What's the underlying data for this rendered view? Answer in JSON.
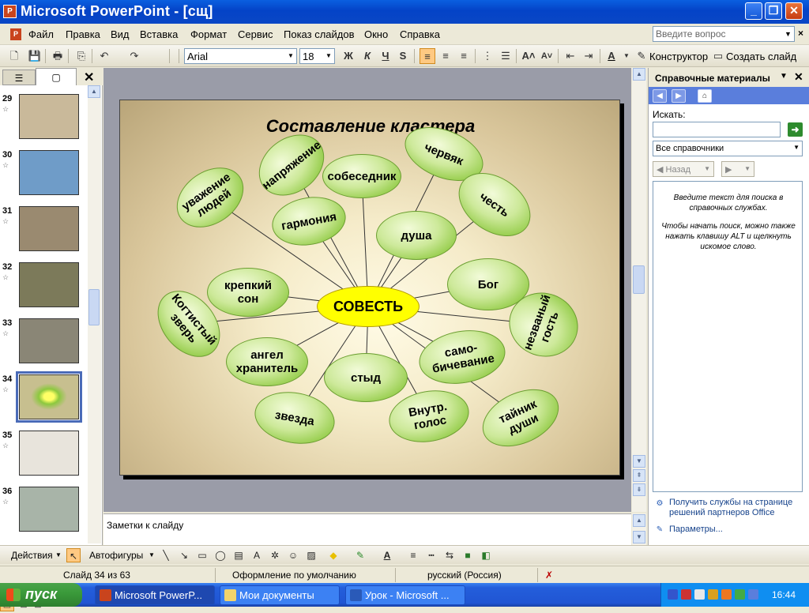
{
  "window": {
    "title": "Microsoft PowerPoint - [сщ]",
    "app_icon": "powerpoint-icon"
  },
  "menu": {
    "items": [
      "Файл",
      "Правка",
      "Вид",
      "Вставка",
      "Формат",
      "Сервис",
      "Показ слайдов",
      "Окно",
      "Справка"
    ],
    "ask_placeholder": "Введите вопрос"
  },
  "toolbar": {
    "font": "Arial",
    "size": "18",
    "designer_label": "Конструктор",
    "new_slide_label": "Создать слайд"
  },
  "slides_panel": {
    "thumbnails": [
      {
        "num": "29",
        "bg": "#c9b99a"
      },
      {
        "num": "30",
        "bg": "#6f9cc8"
      },
      {
        "num": "31",
        "bg": "#9a8a70"
      },
      {
        "num": "32",
        "bg": "#7c7a5a"
      },
      {
        "num": "33",
        "bg": "#8a8676"
      },
      {
        "num": "34",
        "bg": "#c7bf8f"
      },
      {
        "num": "35",
        "bg": "#e8e4dc"
      },
      {
        "num": "36",
        "bg": "#a8b4a8"
      }
    ],
    "selected": "34"
  },
  "slide": {
    "title": "Составление кластера",
    "center": "СОВЕСТЬ",
    "nodes": [
      "уважение\nлюдей",
      "напряжение",
      "собеседник",
      "червяк",
      "честь",
      "гармония",
      "душа",
      "крепкий\nсон",
      "Бог",
      "Когтистый\nзверь",
      "незваный\nгость",
      "ангел\nхранитель",
      "само-\nбичевание",
      "стыд",
      "звезда",
      "Внутр.\nголос",
      "тайник\nдуши"
    ]
  },
  "notes": {
    "placeholder": "Заметки к слайду"
  },
  "taskpane": {
    "title": "Справочные материалы",
    "search_label": "Искать:",
    "search_value": "",
    "source": "Все справочники",
    "back_label": "Назад",
    "info1": "Введите текст для поиска в справочных службах.",
    "info2": "Чтобы начать поиск, можно также нажать клавишу ALT и щелкнуть искомое слово.",
    "link1": "Получить службы на странице решений партнеров Office",
    "link2": "Параметры..."
  },
  "drawing": {
    "actions_label": "Действия",
    "autoshapes_label": "Автофигуры"
  },
  "status": {
    "slide": "Слайд 34 из 63",
    "design": "Оформление по умолчанию",
    "language": "русский (Россия)"
  },
  "taskbar": {
    "start": "пуск",
    "tasks": [
      "Microsoft PowerP...",
      "Мои документы",
      "Урок - Microsoft ..."
    ],
    "time": "16:44"
  }
}
